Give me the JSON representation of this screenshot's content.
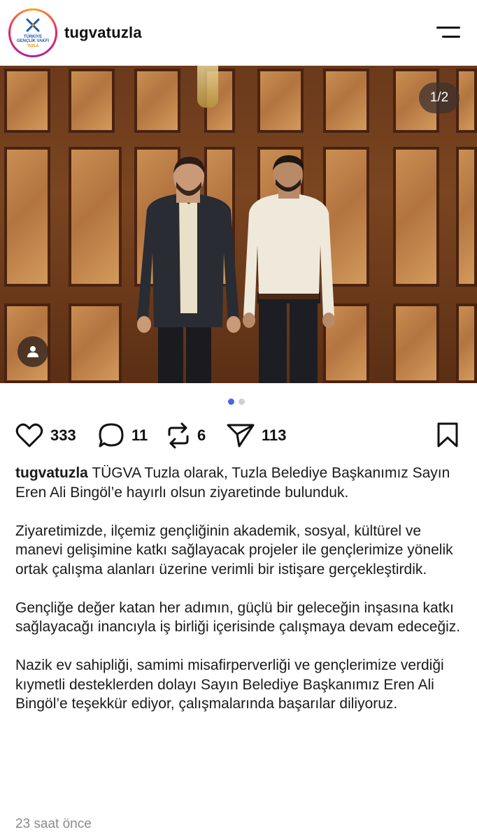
{
  "header": {
    "username": "tugvatuzla",
    "avatar_logo_line1": "TÜRKİYE",
    "avatar_logo_line2": "GENÇLİK VAKFI",
    "avatar_logo_line3": "TUZLA",
    "menu_icon": "hamburger-menu-icon"
  },
  "post": {
    "image_counter": "1/2",
    "carousel": {
      "total": 2,
      "active": 1
    },
    "colors": {
      "active_dot": "#4a63e7",
      "inactive_dot": "#cfcfcf"
    }
  },
  "actions": {
    "likes": "333",
    "comments": "11",
    "reposts": "6",
    "shares": "113"
  },
  "caption": {
    "username": "tugvatuzla",
    "paragraphs": [
      "TÜGVA Tuzla olarak, Tuzla Belediye Başkanımız Sayın Eren Ali Bingöl’e hayırlı olsun ziyaretinde bulunduk.",
      "Ziyaretimizde, ilçemiz gençliğinin akademik, sosyal, kültürel ve manevi gelişimine katkı sağlayacak projeler ile gençlerimize yönelik ortak çalışma alanları üzerine verimli bir istişare gerçekleştirdik.",
      "Gençliğe değer katan her adımın, güçlü bir geleceğin inşasına katkı sağlayacağı inancıyla iş birliği içerisinde çalışmaya devam edeceğiz.",
      "Nazik ev sahipliği, samimi misafirperverliği ve gençlerimize verdiği kıymetli desteklerden dolayı Sayın Belediye Başkanımız Eren Ali Bingöl’e teşekkür ediyor, çalışmalarında başarılar diliyoruz."
    ],
    "timestamp": "23 saat önce"
  }
}
